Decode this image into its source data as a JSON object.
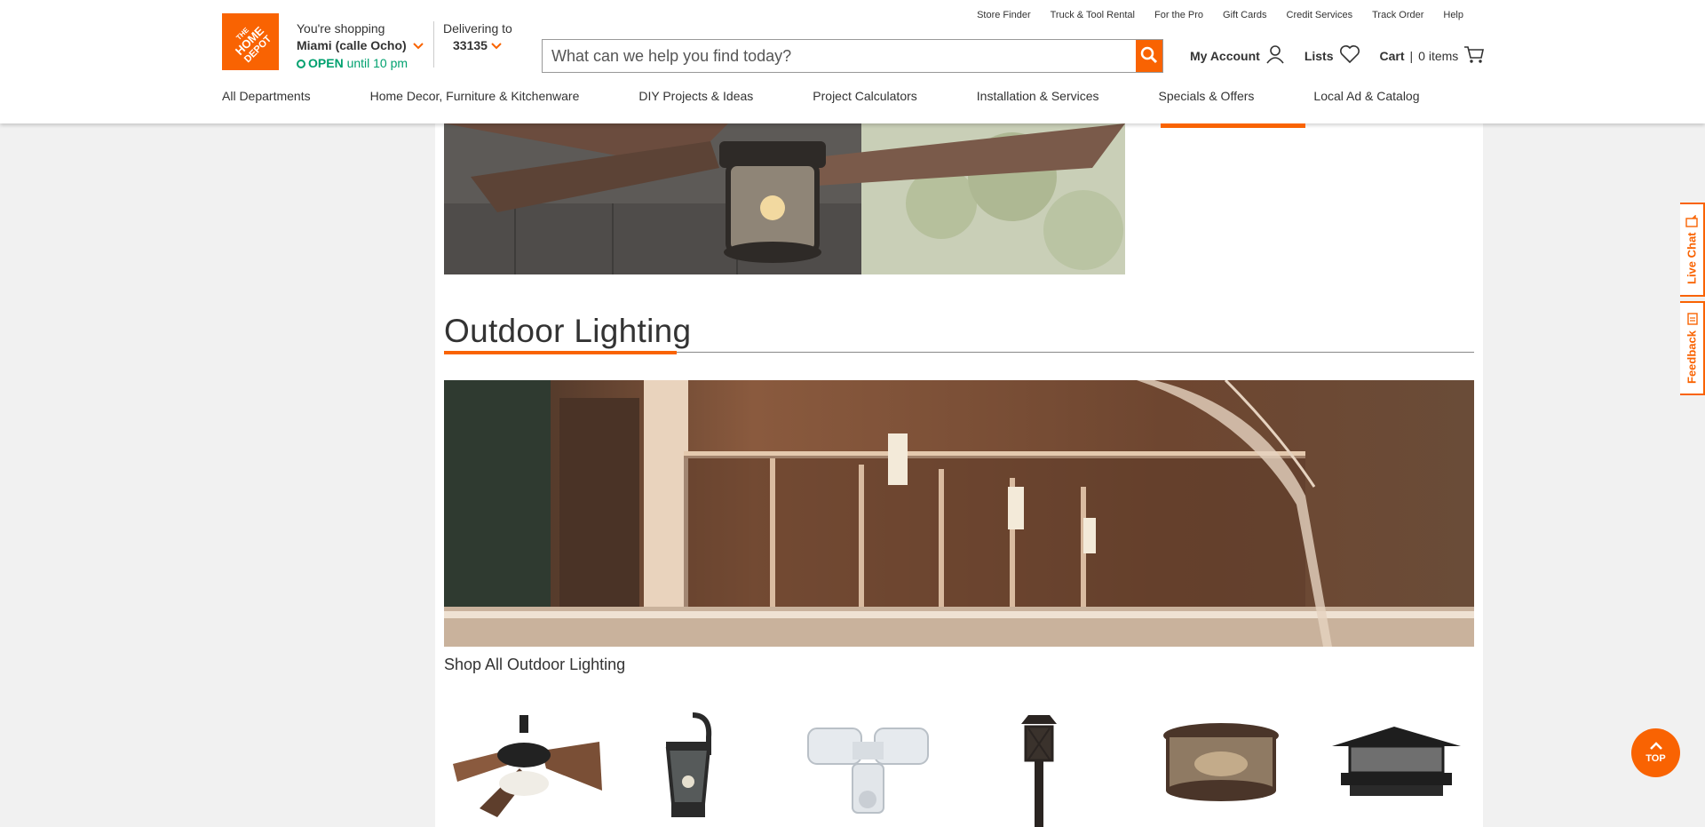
{
  "header": {
    "logo_text": "THE HOME DEPOT",
    "store": {
      "label": "You're shopping",
      "name": "Miami (calle Ocho)",
      "open_label": "OPEN",
      "hours": "until 10 pm"
    },
    "delivery": {
      "label": "Delivering to",
      "zip": "33135"
    },
    "search": {
      "placeholder": "What can we help you find today?"
    },
    "utility_links": [
      "Store Finder",
      "Truck & Tool Rental",
      "For the Pro",
      "Gift Cards",
      "Credit Services",
      "Track Order",
      "Help"
    ],
    "account": {
      "my_account": "My Account",
      "lists": "Lists",
      "cart_label": "Cart",
      "cart_count": "0 items"
    },
    "nav": [
      "All Departments",
      "Home Decor, Furniture & Kitchenware",
      "DIY Projects & Ideas",
      "Project Calculators",
      "Installation & Services",
      "Specials & Offers",
      "Local Ad & Catalog"
    ],
    "active_nav": "Specials & Offers"
  },
  "section": {
    "title": "Outdoor Lighting",
    "shop_all": "Shop All Outdoor Lighting"
  },
  "side_tabs": {
    "live_chat": "Live Chat",
    "feedback": "Feedback"
  },
  "top_button": "TOP",
  "colors": {
    "brand_orange": "#f96302",
    "open_green": "#00a16f"
  },
  "icons": [
    "search-icon",
    "account-icon",
    "heart-icon",
    "cart-icon",
    "chevron-down-icon",
    "chat-icon",
    "feedback-icon",
    "chevron-up-icon"
  ]
}
